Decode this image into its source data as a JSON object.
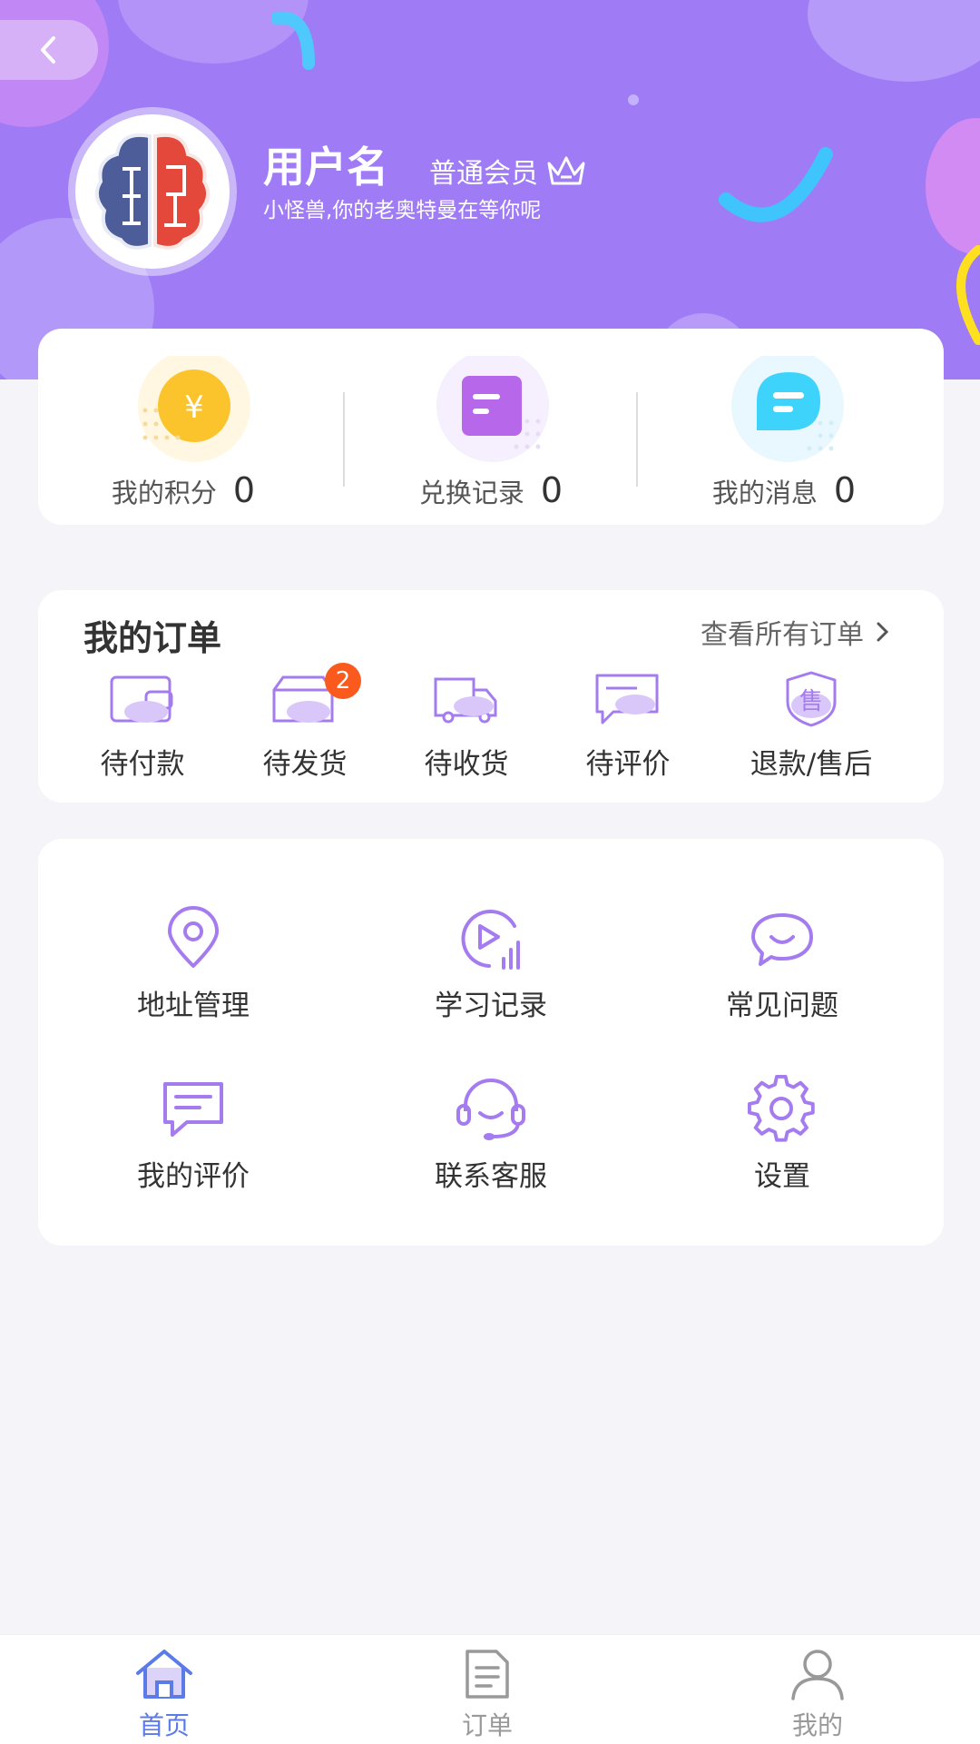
{
  "header": {
    "username": "用户名",
    "member_level": "普通会员",
    "slogan": "小怪兽,你的老奥特曼在等你呢"
  },
  "stats": [
    {
      "label": "我的积分",
      "value": "0",
      "icon": "points-coin-icon"
    },
    {
      "label": "兑换记录",
      "value": "0",
      "icon": "exchange-record-icon"
    },
    {
      "label": "我的消息",
      "value": "0",
      "icon": "message-bubble-icon"
    }
  ],
  "orders": {
    "title": "我的订单",
    "view_all": "查看所有订单",
    "items": [
      {
        "label": "待付款",
        "icon": "wallet-icon"
      },
      {
        "label": "待发货",
        "icon": "package-icon",
        "badge": "2"
      },
      {
        "label": "待收货",
        "icon": "truck-icon"
      },
      {
        "label": "待评价",
        "icon": "review-icon"
      },
      {
        "label": "退款/售后",
        "icon": "after-sale-shield-icon",
        "icon_text": "售"
      }
    ]
  },
  "tools": [
    {
      "label": "地址管理",
      "icon": "location-pin-icon"
    },
    {
      "label": "学习记录",
      "icon": "play-record-icon"
    },
    {
      "label": "常见问题",
      "icon": "faq-smile-icon"
    },
    {
      "label": "我的评价",
      "icon": "comment-icon"
    },
    {
      "label": "联系客服",
      "icon": "headset-icon"
    },
    {
      "label": "设置",
      "icon": "gear-icon"
    }
  ],
  "tabbar": [
    {
      "label": "首页",
      "icon": "home-icon",
      "active": true
    },
    {
      "label": "订单",
      "icon": "document-icon",
      "active": false
    },
    {
      "label": "我的",
      "icon": "user-icon",
      "active": false
    }
  ],
  "colors": {
    "header_bg": "#9f7cf6",
    "accent_purple": "#a57cf0",
    "active_tab": "#5b7be8",
    "inactive_tab": "#999999",
    "badge": "#fa5a1e",
    "coin_yellow": "#fcc42c",
    "message_cyan": "#3ed3fb"
  }
}
